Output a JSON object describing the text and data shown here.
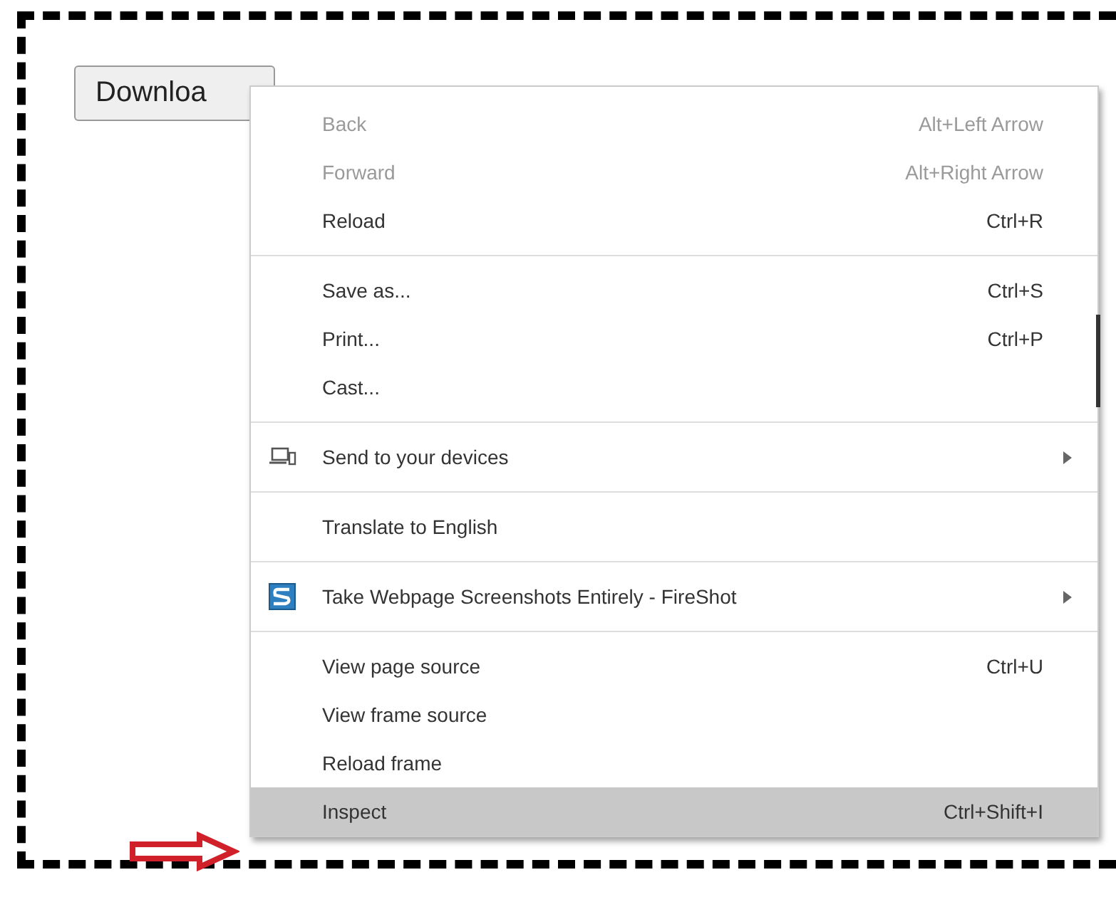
{
  "page": {
    "button": "Downloa"
  },
  "context_menu": {
    "groups": [
      [
        {
          "label": "Back",
          "shortcut": "Alt+Left Arrow",
          "disabled": true,
          "selected": false,
          "submenu": false
        },
        {
          "label": "Forward",
          "shortcut": "Alt+Right Arrow",
          "disabled": true,
          "selected": false,
          "submenu": false
        },
        {
          "label": "Reload",
          "shortcut": "Ctrl+R",
          "disabled": false,
          "selected": false,
          "submenu": false
        }
      ],
      [
        {
          "label": "Save as...",
          "shortcut": "Ctrl+S",
          "disabled": false,
          "selected": false,
          "submenu": false
        },
        {
          "label": "Print...",
          "shortcut": "Ctrl+P",
          "disabled": false,
          "selected": false,
          "submenu": false
        },
        {
          "label": "Cast...",
          "disabled": false,
          "selected": false,
          "submenu": false
        }
      ],
      [
        {
          "label": "Send to your devices",
          "kind": "devices",
          "disabled": false,
          "selected": false,
          "submenu": true
        }
      ],
      [
        {
          "label": "Translate to English",
          "disabled": false,
          "selected": false,
          "submenu": false
        }
      ],
      [
        {
          "label": "Take Webpage Screenshots Entirely - FireShot",
          "kind": "fireshot",
          "disabled": false,
          "selected": false,
          "submenu": true
        }
      ],
      [
        {
          "label": "View page source",
          "shortcut": "Ctrl+U",
          "disabled": false,
          "selected": false,
          "submenu": false
        },
        {
          "label": "View frame source",
          "disabled": false,
          "selected": false,
          "submenu": false
        },
        {
          "label": "Reload frame",
          "disabled": false,
          "selected": false,
          "submenu": false
        },
        {
          "label": "Inspect",
          "shortcut": "Ctrl+Shift+I",
          "disabled": false,
          "selected": true,
          "submenu": false
        }
      ]
    ]
  }
}
